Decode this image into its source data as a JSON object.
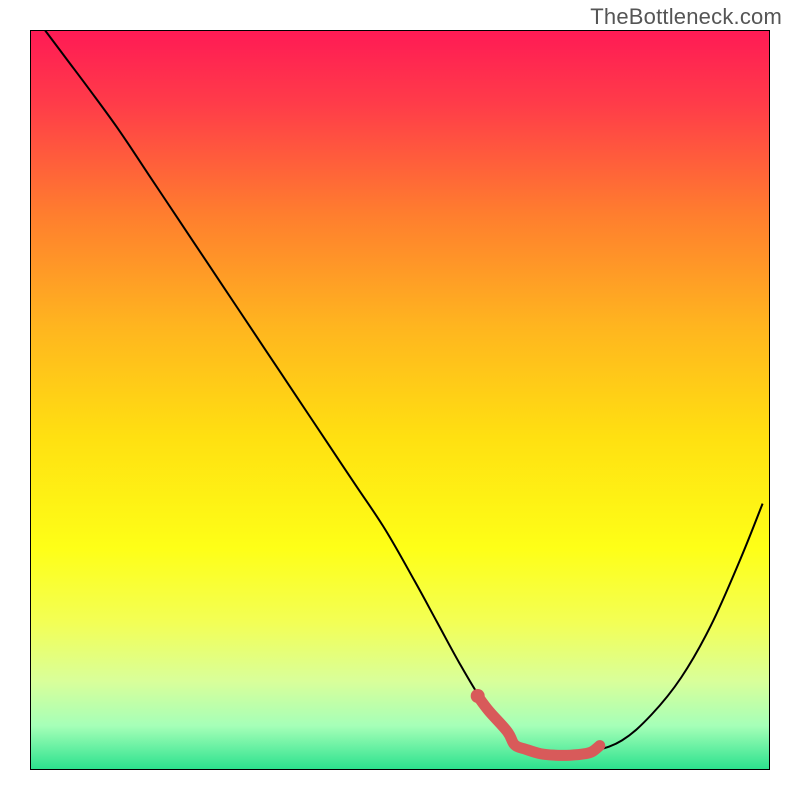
{
  "watermark": "TheBottleneck.com",
  "chart_data": {
    "type": "line",
    "title": "",
    "xlabel": "",
    "ylabel": "",
    "xlim": [
      0,
      100
    ],
    "ylim": [
      0,
      100
    ],
    "grid": false,
    "legend": false,
    "background_gradient": {
      "stops": [
        {
          "offset": 0.0,
          "color": "#ff1a55"
        },
        {
          "offset": 0.1,
          "color": "#ff3c49"
        },
        {
          "offset": 0.25,
          "color": "#ff7e2e"
        },
        {
          "offset": 0.4,
          "color": "#ffb51f"
        },
        {
          "offset": 0.55,
          "color": "#ffe011"
        },
        {
          "offset": 0.7,
          "color": "#feff17"
        },
        {
          "offset": 0.8,
          "color": "#f3ff55"
        },
        {
          "offset": 0.88,
          "color": "#d9ff9a"
        },
        {
          "offset": 0.94,
          "color": "#a6ffb8"
        },
        {
          "offset": 1.0,
          "color": "#29e18d"
        }
      ]
    },
    "series": [
      {
        "name": "bottleneck-curve",
        "color": "#000000",
        "width": 2,
        "x": [
          2,
          5,
          8,
          12,
          16,
          20,
          24,
          28,
          32,
          36,
          40,
          44,
          48,
          52,
          55,
          58,
          61,
          64,
          67,
          70,
          73,
          76,
          80,
          84,
          88,
          92,
          96,
          99
        ],
        "y": [
          100,
          96,
          92,
          86.5,
          80.5,
          74.5,
          68.5,
          62.5,
          56.5,
          50.5,
          44.5,
          38.5,
          32.5,
          25.5,
          20.0,
          14.5,
          9.5,
          5.5,
          3.0,
          2.0,
          2.0,
          2.5,
          4.0,
          7.5,
          12.5,
          19.5,
          28.5,
          36.0
        ]
      },
      {
        "name": "highlight-segment",
        "color": "#d85a5a",
        "width": 11,
        "linecap": "round",
        "x": [
          60.5,
          62.0,
          64.5,
          65.5,
          67.0,
          69.0,
          71.0,
          73.0,
          75.0,
          76.0,
          77.0
        ],
        "y": [
          10.0,
          8.0,
          5.2,
          3.4,
          2.8,
          2.2,
          2.0,
          2.0,
          2.2,
          2.5,
          3.3
        ]
      },
      {
        "name": "highlight-dot",
        "type": "scatter",
        "color": "#d85a5a",
        "radius": 7,
        "x": [
          60.5
        ],
        "y": [
          10.0
        ]
      }
    ]
  }
}
